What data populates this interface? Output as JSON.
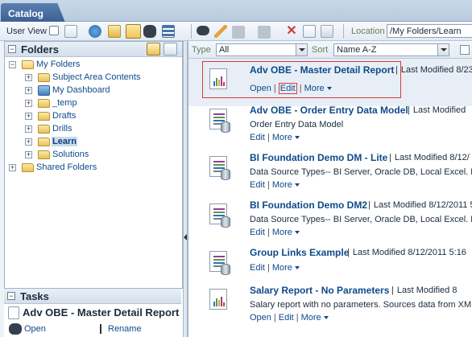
{
  "tab": {
    "label": "Catalog"
  },
  "toolbar": {
    "user_view_label": "User View",
    "location_label": "Location",
    "location_value": "/My Folders/Learn"
  },
  "folders": {
    "title": "Folders",
    "tree": [
      {
        "label": "My Folders",
        "level": 0,
        "expand": "-",
        "open": true
      },
      {
        "label": "Subject Area Contents",
        "level": 1,
        "expand": "+"
      },
      {
        "label": "My Dashboard",
        "level": 1,
        "expand": "+",
        "icon": "dashboard-icon"
      },
      {
        "label": "_temp",
        "level": 1,
        "expand": "+"
      },
      {
        "label": "Drafts",
        "level": 1,
        "expand": "+"
      },
      {
        "label": "Drills",
        "level": 1,
        "expand": "+"
      },
      {
        "label": "Learn",
        "level": 1,
        "expand": "+",
        "selected": true
      },
      {
        "label": "Solutions",
        "level": 1,
        "expand": "+"
      },
      {
        "label": "Shared Folders",
        "level": 0,
        "expand": "+"
      }
    ]
  },
  "tasks": {
    "title": "Tasks",
    "item": "Adv OBE - Master Detail Report",
    "open_label": "Open",
    "rename_label": "Rename"
  },
  "filter": {
    "type_label": "Type",
    "type_value": "All",
    "sort_label": "Sort",
    "sort_value": "Name A-Z"
  },
  "items": [
    {
      "title": "Adv OBE - Master Detail Report",
      "modified": "Last Modified 8/23",
      "desc": "",
      "actions": [
        "Open",
        "Edit",
        "More"
      ],
      "icon": "report",
      "selected": true
    },
    {
      "title": "Adv OBE - Order Entry Data Model",
      "modified": "Last Modified",
      "desc": "Order Entry Data Model",
      "actions": [
        "Edit",
        "More"
      ],
      "icon": "datamodel"
    },
    {
      "title": "BI Foundation Demo DM - Lite",
      "modified": "Last Modified 8/12/",
      "desc": "Data Source Types-- BI Server, Oracle DB, Local Excel. Da",
      "actions": [
        "Edit",
        "More"
      ],
      "icon": "datamodel"
    },
    {
      "title": "BI Foundation Demo DM2",
      "modified": "Last Modified 8/12/2011 5",
      "desc": "Data Source Types-- BI Server, Oracle DB, Local Excel. Da",
      "actions": [
        "Edit",
        "More"
      ],
      "icon": "datamodel"
    },
    {
      "title": "Group Links Example",
      "modified": "Last Modified 8/12/2011 5:16",
      "desc": "",
      "actions": [
        "Edit",
        "More"
      ],
      "icon": "datamodel"
    },
    {
      "title": "Salary Report - No Parameters",
      "modified": "Last Modified 8",
      "desc": "Salary report with no parameters. Sources data from XML",
      "actions": [
        "Open",
        "Edit",
        "More"
      ],
      "icon": "report"
    }
  ]
}
